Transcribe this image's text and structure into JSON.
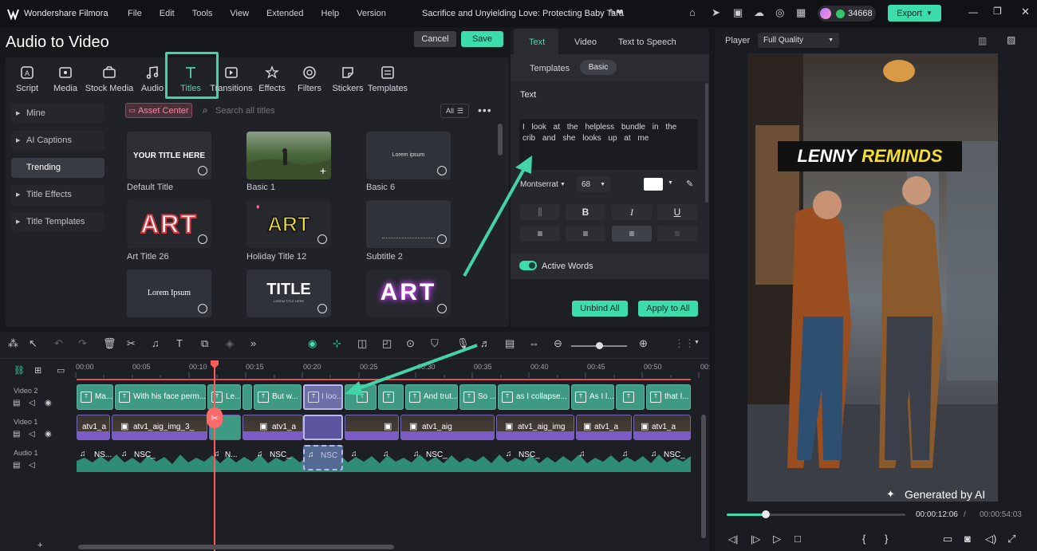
{
  "app": {
    "name": "Wondershare Filmora",
    "project_title": "Sacrifice and Unyielding Love: Protecting Baby Tara",
    "credits": "34668",
    "export_label": "Export"
  },
  "menu": [
    "File",
    "Edit",
    "Tools",
    "View",
    "Extended",
    "Help",
    "Version"
  ],
  "panel": {
    "title": "Audio to Video",
    "cancel": "Cancel",
    "save": "Save"
  },
  "toolbar": [
    "Script",
    "Media",
    "Stock Media",
    "Audio",
    "Titles",
    "Transitions",
    "Effects",
    "Filters",
    "Stickers",
    "Templates"
  ],
  "sidebar": [
    "Mine",
    "AI Captions",
    "Trending",
    "Title Effects",
    "Title Templates"
  ],
  "browser": {
    "asset_center": "Asset Center",
    "search_placeholder": "Search all titles",
    "filter_all": "All"
  },
  "titles": [
    {
      "label": "Default Title",
      "thumb_text": "YOUR TITLE HERE"
    },
    {
      "label": "Basic 1",
      "thumb_text": ""
    },
    {
      "label": "Basic 6",
      "thumb_text": "Lorem ipsum"
    },
    {
      "label": "Art Title 26",
      "thumb_text": "ART"
    },
    {
      "label": "Holiday Title 12",
      "thumb_text": "ART"
    },
    {
      "label": "Subtitle 2",
      "thumb_text": ""
    },
    {
      "label": "",
      "thumb_text": "Lorem Ipsum"
    },
    {
      "label": "",
      "thumb_text": "TITLE",
      "thumb_sub": "LOREM TITLE HERE"
    },
    {
      "label": "",
      "thumb_text": "ART"
    }
  ],
  "props": {
    "tabs": [
      "Text",
      "Video",
      "Text to Speech"
    ],
    "subtabs": [
      "Templates",
      "Basic"
    ],
    "section": "Text",
    "text_value": "I look at the helpless bundle in the crib and she looks up at me",
    "font": "Montserrat",
    "size": "68",
    "bold": "B",
    "italic": "I",
    "underline": "U",
    "active_words": "Active Words",
    "unbind_all": "Unbind All",
    "apply_to_all": "Apply to All"
  },
  "player": {
    "label": "Player",
    "quality": "Full Quality",
    "overlay_title_white": "LENNY",
    "overlay_title_yellow": "REMINDS",
    "watermark": "Generated by AI",
    "current_time": "00:00:12:06",
    "total_time": "00:00:54:03",
    "progress": 0.1
  },
  "timeline": {
    "ruler": [
      "00:00",
      "00:05",
      "00:10",
      "00:15",
      "00:20",
      "00:25",
      "00:30",
      "00:35",
      "00:40",
      "00:45",
      "00:50",
      "00:"
    ],
    "tracks": [
      "Video 2",
      "Video 1",
      "Audio 1"
    ],
    "title_clips": [
      "Ma...",
      "With his face perm...",
      "Le...",
      "",
      "But w...",
      "I loo...",
      "",
      "",
      "And trut...",
      "So ...",
      "as I collapse...",
      "As I l...",
      "",
      "that I..."
    ],
    "video_clips": [
      "atv1_a",
      "atv1_aig_img_3_",
      "",
      "atv1_a",
      "",
      "atv1_aig",
      "atv1_aig_img",
      "atv1_a",
      "atv1_a"
    ],
    "audio_clips": [
      "NS...",
      "NSC_",
      "N...",
      "NSC_",
      "NSC",
      "",
      "",
      "NSC_",
      "NSC_",
      "",
      "",
      "NSC_"
    ]
  },
  "colors": {
    "accent": "#43d3a8",
    "selection": "#4fd3b0",
    "playhead": "#ff5b5b",
    "overlay_yellow": "#f4df2e"
  }
}
